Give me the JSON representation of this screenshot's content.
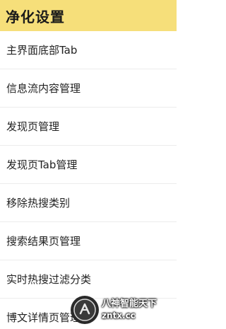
{
  "header": {
    "title": "净化设置"
  },
  "menu": {
    "items": [
      {
        "label": "主界面底部Tab"
      },
      {
        "label": "信息流内容管理"
      },
      {
        "label": "发现页管理"
      },
      {
        "label": "发现页Tab管理"
      },
      {
        "label": "移除热搜类别"
      },
      {
        "label": "搜索结果页管理"
      },
      {
        "label": "实时热搜过滤分类"
      },
      {
        "label": "博文详情页管理"
      }
    ]
  },
  "watermark": {
    "line1": "八神智能天下",
    "line2": "zntx.cc"
  },
  "colors": {
    "header_bg": "#f6df7a",
    "text": "#222222",
    "divider": "#ececec"
  }
}
